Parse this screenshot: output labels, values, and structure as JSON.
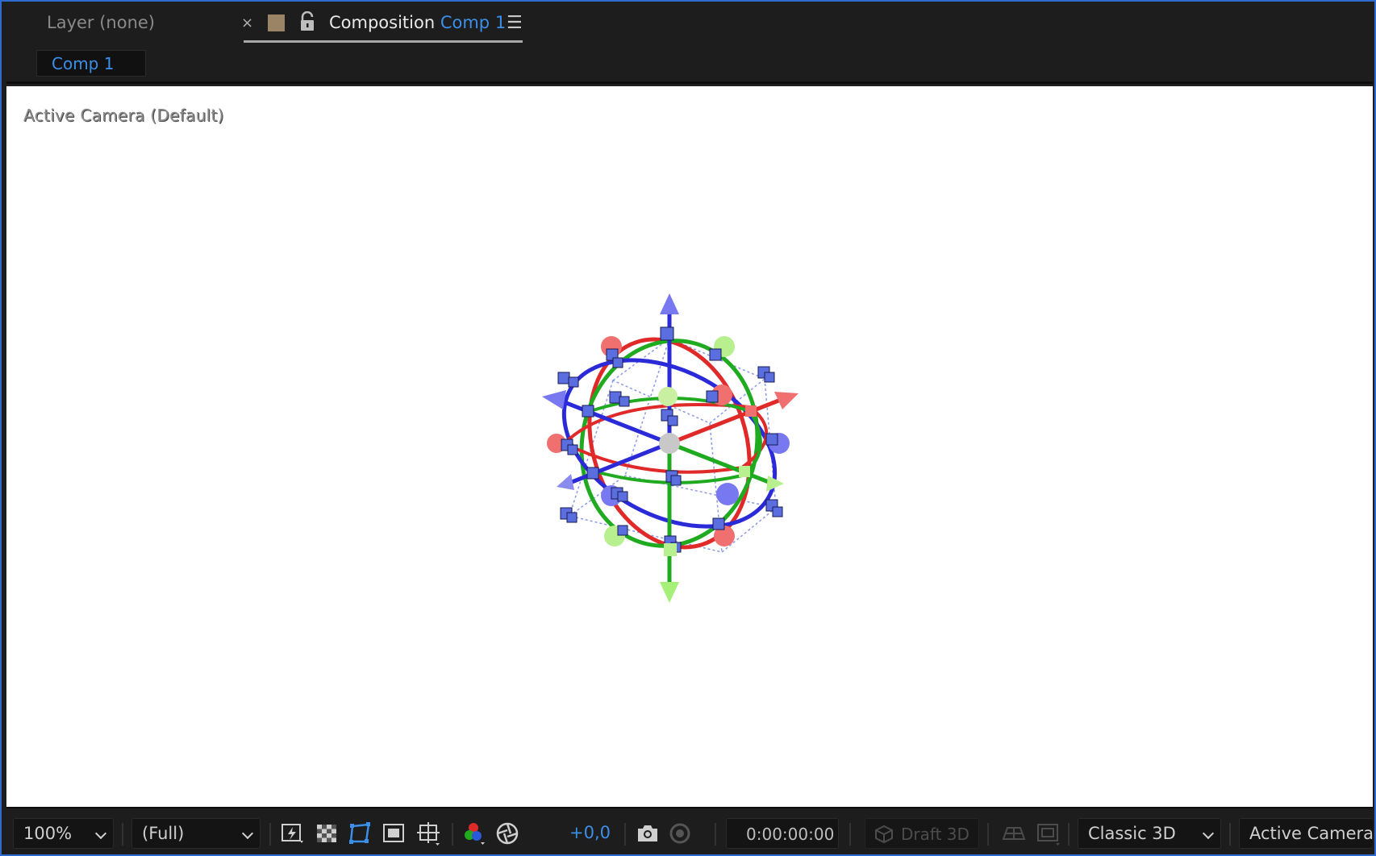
{
  "tabs": {
    "layer_tab": "Layer (none)",
    "close": "×",
    "comp_prefix": "Composition",
    "comp_name": "Comp 1",
    "menu": "☰",
    "swatch_color": "#9b8465"
  },
  "breadcrumb": {
    "label": "Comp 1"
  },
  "viewer": {
    "camera_label": "Active Camera (Default)",
    "background": "#ffffff"
  },
  "toolbar": {
    "zoom": "100%",
    "resolution": "(Full)",
    "exposure": "+0,0",
    "timecode": "0:00:00:00",
    "draft3d": "Draft 3D",
    "renderer": "Classic 3D",
    "view": "Active Camera ..."
  },
  "colors": {
    "accent": "#3b8fe8",
    "x_axis": "#e02a2a",
    "y_axis": "#1faa1f",
    "z_axis": "#2a2ad8"
  }
}
